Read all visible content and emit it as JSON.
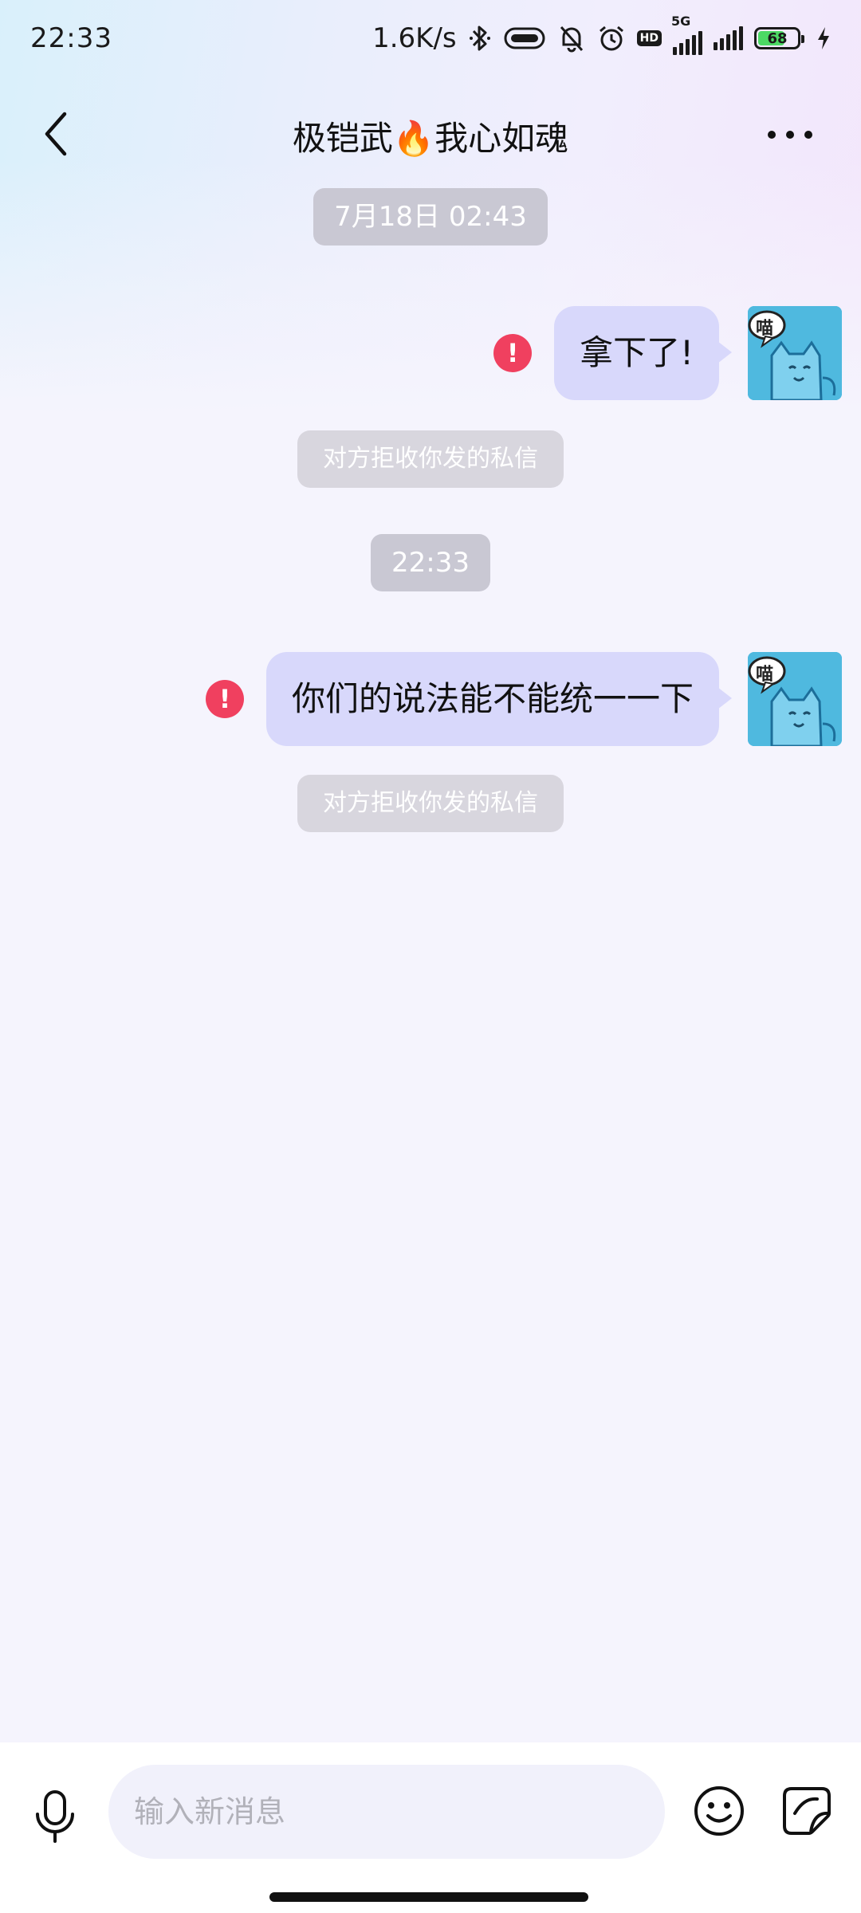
{
  "status_bar": {
    "time": "22:33",
    "net_speed": "1.6K/s",
    "network_type": "5G",
    "hd_label": "HD",
    "battery_level": "68",
    "battery_fraction": 0.68,
    "icons": [
      "bluetooth-icon",
      "vibrate-icon",
      "bell-muted-icon",
      "alarm-icon",
      "hd-icon",
      "signal-icon",
      "battery-icon",
      "charging-icon"
    ]
  },
  "header": {
    "title": "极铠武🔥我心如魂",
    "back_icon": "chevron-left-icon",
    "more_icon": "more-dots-icon"
  },
  "messages": [
    {
      "type": "timestamp",
      "text": "7月18日 02:43"
    },
    {
      "type": "outgoing",
      "text": "拿下了!",
      "status": "failed",
      "avatar_text": "喵"
    },
    {
      "type": "notice",
      "text": "对方拒收你发的私信"
    },
    {
      "type": "timestamp",
      "text": "22:33"
    },
    {
      "type": "outgoing",
      "text": "你们的说法能不能统一一下",
      "status": "failed",
      "avatar_text": "喵"
    },
    {
      "type": "notice",
      "text": "对方拒收你发的私信"
    }
  ],
  "input_bar": {
    "placeholder": "输入新消息",
    "value": "",
    "icons": [
      "microphone-icon",
      "emoji-icon",
      "sticker-icon"
    ]
  },
  "colors": {
    "bubble": "#d8d8fb",
    "error": "#f0405f",
    "chip": "#c9c8d3",
    "background": "#f5f4fd"
  }
}
